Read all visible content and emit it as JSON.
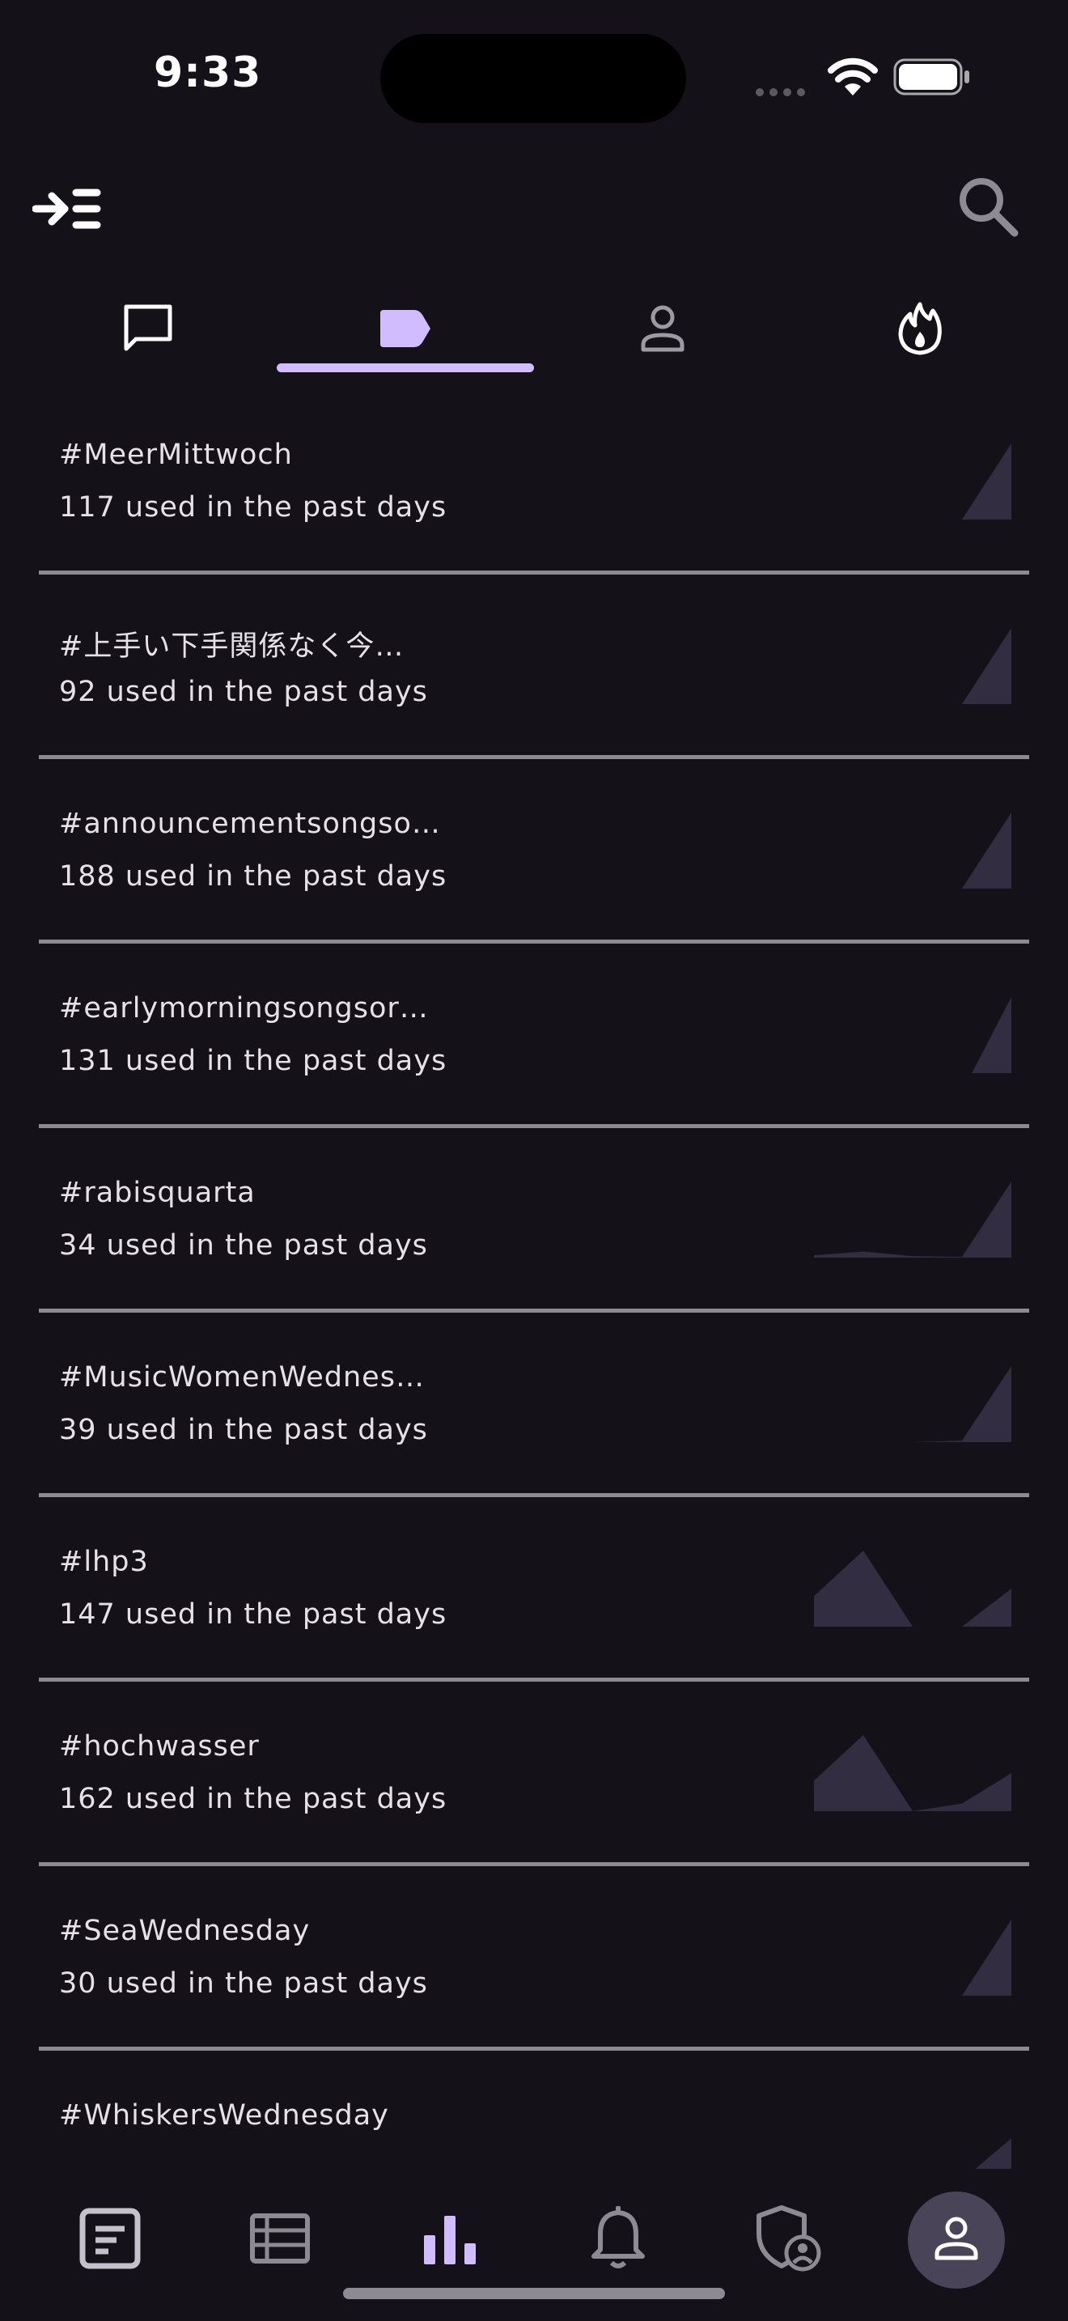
{
  "status_bar": {
    "time": "9:33"
  },
  "tabs": [
    {
      "name": "posts",
      "icon": "chat-bubble-icon",
      "selected": false
    },
    {
      "name": "hashtags",
      "icon": "tag-icon",
      "selected": true
    },
    {
      "name": "people",
      "icon": "person-icon",
      "selected": false
    },
    {
      "name": "trending",
      "icon": "flame-icon",
      "selected": false
    }
  ],
  "colors": {
    "background": "#141218",
    "accent": "#d0bcff",
    "sparkline_fill": "#332d41",
    "divider": "#8e8a94"
  },
  "trends": [
    {
      "tag": "#MeerMittwoch",
      "usage": "117 used in the past days",
      "history": [
        0,
        0,
        0,
        0,
        1
      ]
    },
    {
      "tag": "#上手い下手関係なく今…",
      "usage": "92 used in the past days",
      "history": [
        0,
        0,
        0,
        0,
        1
      ]
    },
    {
      "tag": "#announcementsongso…",
      "usage": "188 used in the past days",
      "history": [
        0,
        0,
        0,
        0,
        1
      ]
    },
    {
      "tag": "#earlymorningsongsor…",
      "usage": "131 used in the past days",
      "history": [
        0,
        0,
        0,
        0,
        0,
        1
      ]
    },
    {
      "tag": "#rabisquarta",
      "usage": "34 used in the past days",
      "history": [
        0.03,
        0.08,
        0.02,
        0.01,
        1
      ]
    },
    {
      "tag": "#MusicWomenWednes…",
      "usage": "39 used in the past days",
      "history": [
        0,
        0,
        0,
        0.02,
        1
      ]
    },
    {
      "tag": "#lhp3",
      "usage": "147 used in the past days",
      "history": [
        0.4,
        1,
        0,
        0,
        0.5
      ]
    },
    {
      "tag": "#hochwasser",
      "usage": "162 used in the past days",
      "history": [
        0.4,
        1,
        0,
        0.1,
        0.5
      ]
    },
    {
      "tag": "#SeaWednesday",
      "usage": "30 used in the past days",
      "history": [
        0,
        0,
        0,
        0,
        1
      ]
    },
    {
      "tag": "#WhiskersWednesday",
      "usage": "",
      "history": [
        0,
        0,
        0,
        0,
        0.55
      ]
    }
  ],
  "bottom_nav": [
    {
      "name": "timeline",
      "icon": "feed-icon"
    },
    {
      "name": "lists",
      "icon": "list-icon"
    },
    {
      "name": "explore",
      "icon": "bar-chart-icon",
      "selected": true
    },
    {
      "name": "notifications",
      "icon": "bell-icon"
    },
    {
      "name": "moderation",
      "icon": "shield-person-icon"
    },
    {
      "name": "account",
      "icon": "person-icon"
    }
  ]
}
